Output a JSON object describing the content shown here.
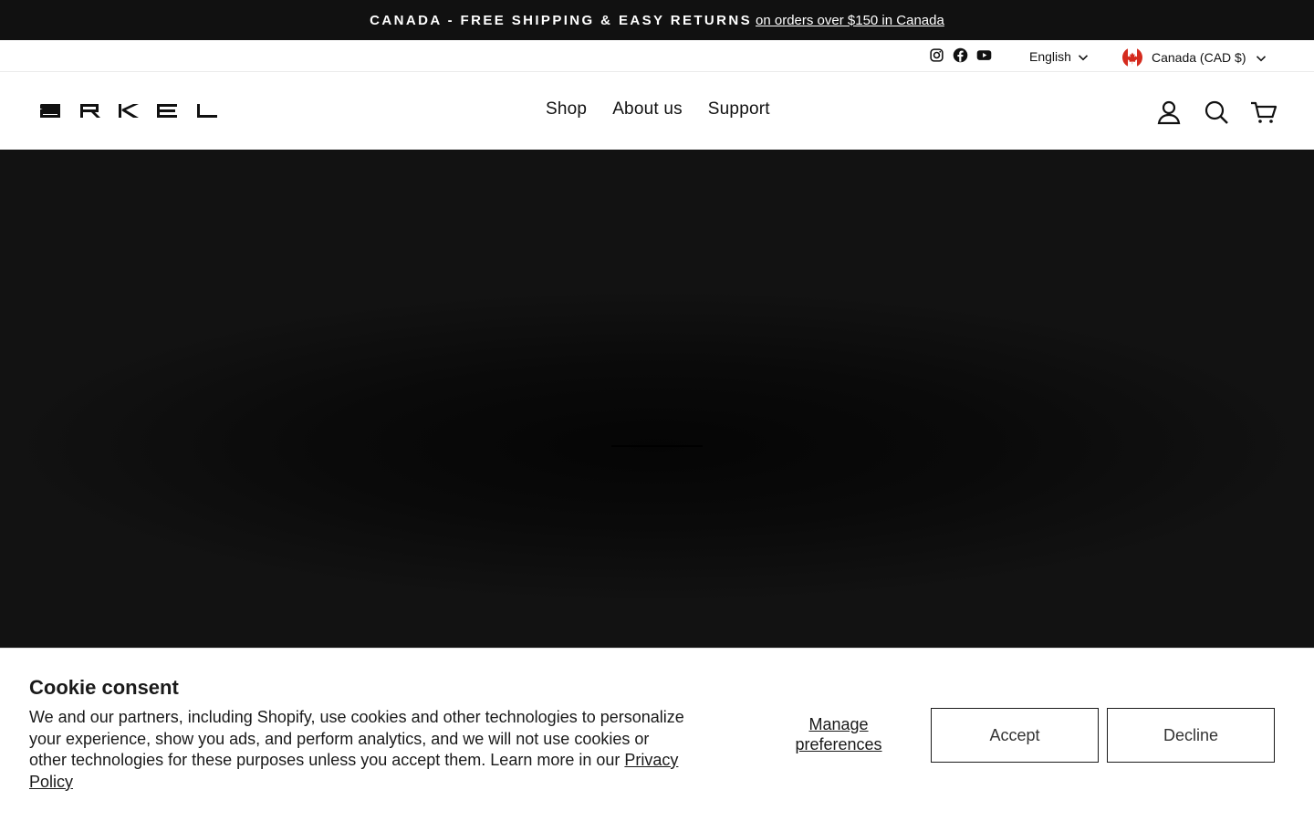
{
  "announcement": {
    "headline": "CANADA - FREE SHIPPING & EASY RETURNS",
    "link_text": "on orders over $150 in Canada"
  },
  "utility_bar": {
    "social_icons": [
      "instagram-icon",
      "facebook-icon",
      "youtube-icon"
    ],
    "language": "English",
    "currency": "Canada (CAD $)"
  },
  "header": {
    "logo_text": "ARKEL",
    "nav": [
      "Shop",
      "About us",
      "Support"
    ],
    "icons": [
      "account-icon",
      "search-icon",
      "cart-icon"
    ]
  },
  "cookie_banner": {
    "title": "Cookie consent",
    "body": "We and our partners, including Shopify, use cookies and other technologies to personalize your experience, show you ads, and perform analytics, and we will not use cookies or other technologies for these purposes unless you accept them. Learn more in our ",
    "privacy_link": "Privacy Policy",
    "manage_line1": "Manage",
    "manage_line2": "preferences",
    "accept": "Accept",
    "decline": "Decline"
  },
  "colors": {
    "announcement_bg": "#111111",
    "hero_bg": "#121212",
    "canada_red": "#d52b1e"
  }
}
